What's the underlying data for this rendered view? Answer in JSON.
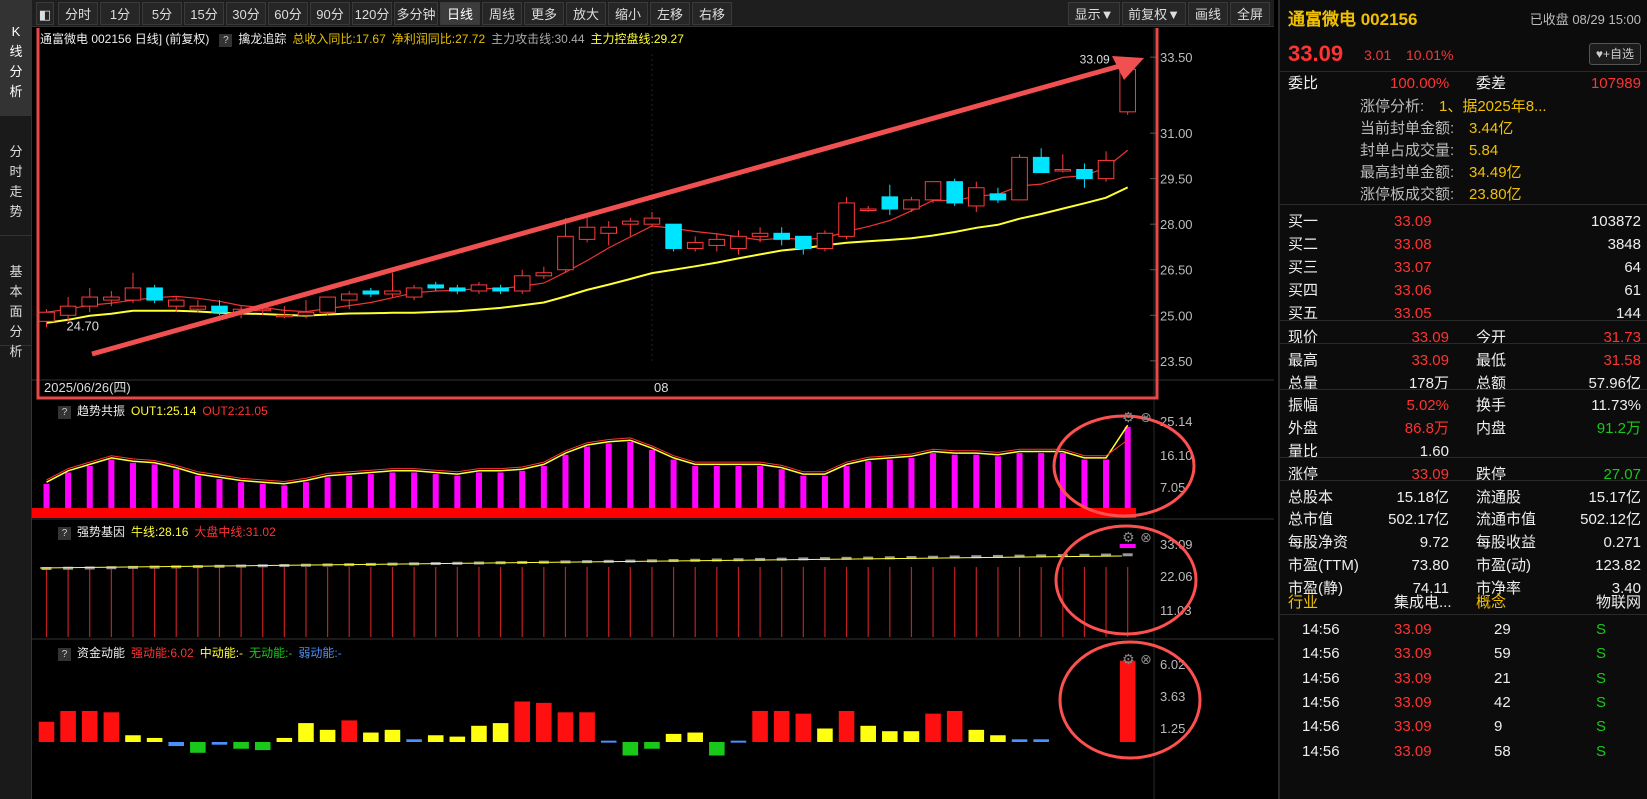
{
  "left_tabs": [
    "K线分析",
    "分时走势",
    "基本面分析"
  ],
  "toolbar": {
    "left": [
      "分时",
      "1分",
      "5分",
      "15分",
      "30分",
      "60分",
      "90分",
      "120分",
      "多分钟",
      "日线",
      "周线",
      "更多▼",
      "放大",
      "缩小",
      "左移",
      "右移"
    ],
    "right": [
      "显示▼",
      "前复权▼",
      "画线",
      "全屏"
    ],
    "active": "日线"
  },
  "main_panel": {
    "title": "通富微电 002156 日线] (前复权)",
    "indicator": "擒龙追踪",
    "vals": [
      {
        "t": "总收入同比:17.67",
        "c": "#e8c000"
      },
      {
        "t": "净利润同比:27.72",
        "c": "#e8c000"
      },
      {
        "t": "主力攻击线:30.44",
        "c": "#aaaaaa"
      },
      {
        "t": "主力控盘线:29.27",
        "c": "#ffff33"
      }
    ],
    "last_price_label": "33.09",
    "low_label": "24.70",
    "date_left": "2025/06/26(四)",
    "month_mark": "08",
    "ticks": [
      "33.50",
      "31.00",
      "29.50",
      "28.00",
      "26.50",
      "25.00",
      "23.50"
    ]
  },
  "trend_panel": {
    "name": "趋势共振",
    "vals": [
      {
        "t": "OUT1:25.14",
        "c": "#ffff33"
      },
      {
        "t": "OUT2:21.05",
        "c": "#ff3333"
      }
    ],
    "ticks": [
      "25.14",
      "16.10",
      "7.05"
    ]
  },
  "gene_panel": {
    "name": "强势基因",
    "vals": [
      {
        "t": "牛线:28.16",
        "c": "#ffff33"
      },
      {
        "t": "大盘中线:31.02",
        "c": "#ff3333"
      }
    ],
    "ticks": [
      "33.09",
      "22.06",
      "11.03"
    ]
  },
  "fund_panel": {
    "name": "资金动能",
    "vals": [
      {
        "t": "强动能:6.02",
        "c": "#ff3333"
      },
      {
        "t": "中动能:-",
        "c": "#ffff33"
      },
      {
        "t": "无动能:-",
        "c": "#19c819"
      },
      {
        "t": "弱动能:-",
        "c": "#4a90ff"
      }
    ],
    "ticks": [
      "6.02",
      "3.63",
      "1.25"
    ]
  },
  "quote": {
    "name": "通富微电 002156",
    "status": "已收盘 08/29 15:00",
    "price": "33.09",
    "change": "3.01",
    "change_pct": "10.01%",
    "add_fav": "+自选",
    "weibi_label": "委比",
    "weibi": "100.00%",
    "weicha_label": "委差",
    "weicha": "107989",
    "limit_info": [
      {
        "k": "涨停分析:",
        "v": "1、据2025年8..."
      },
      {
        "k": "当前封单金额:",
        "v": "3.44亿"
      },
      {
        "k": "封单占成交量:",
        "v": "5.84"
      },
      {
        "k": "最高封单金额:",
        "v": "34.49亿"
      },
      {
        "k": "涨停板成交额:",
        "v": "23.80亿"
      }
    ],
    "bids": [
      {
        "k": "买一",
        "p": "33.09",
        "v": "103872"
      },
      {
        "k": "买二",
        "p": "33.08",
        "v": "3848"
      },
      {
        "k": "买三",
        "p": "33.07",
        "v": "64"
      },
      {
        "k": "买四",
        "p": "33.06",
        "v": "61"
      },
      {
        "k": "买五",
        "p": "33.05",
        "v": "144"
      }
    ],
    "stats": [
      {
        "k1": "现价",
        "v1": "33.09",
        "c1": "red",
        "k2": "今开",
        "v2": "31.73",
        "c2": "red"
      },
      {
        "k1": "最高",
        "v1": "33.09",
        "c1": "red",
        "k2": "最低",
        "v2": "31.58",
        "c2": "red"
      },
      {
        "k1": "总量",
        "v1": "178万",
        "c1": "white",
        "k2": "总额",
        "v2": "57.96亿",
        "c2": "white"
      },
      {
        "k1": "振幅",
        "v1": "5.02%",
        "c1": "red",
        "k2": "换手",
        "v2": "11.73%",
        "c2": "white"
      },
      {
        "k1": "外盘",
        "v1": "86.8万",
        "c1": "red",
        "k2": "内盘",
        "v2": "91.2万",
        "c2": "green"
      },
      {
        "k1": "量比",
        "v1": "1.60",
        "c1": "white",
        "k2": "",
        "v2": "",
        "c2": "white"
      },
      {
        "k1": "涨停",
        "v1": "33.09",
        "c1": "red",
        "k2": "跌停",
        "v2": "27.07",
        "c2": "green"
      },
      {
        "k1": "总股本",
        "v1": "15.18亿",
        "c1": "white",
        "k2": "流通股",
        "v2": "15.17亿",
        "c2": "white"
      },
      {
        "k1": "总市值",
        "v1": "502.17亿",
        "c1": "white",
        "k2": "流通市值",
        "v2": "502.12亿",
        "c2": "white"
      },
      {
        "k1": "每股净资",
        "v1": "9.72",
        "c1": "white",
        "k2": "每股收益",
        "v2": "0.271",
        "c2": "white"
      },
      {
        "k1": "市盈(TTM)",
        "v1": "73.80",
        "c1": "white",
        "k2": "市盈(动)",
        "v2": "123.82",
        "c2": "white"
      },
      {
        "k1": "市盈(静)",
        "v1": "74.11",
        "c1": "white",
        "k2": "市净率",
        "v2": "3.40",
        "c2": "white"
      }
    ],
    "industry_label": "行业",
    "industry": "集成电...",
    "concept_label": "概念",
    "concept": "物联网",
    "ticks": [
      {
        "t": "14:56",
        "p": "33.09",
        "v": "29",
        "s": "S"
      },
      {
        "t": "14:56",
        "p": "33.09",
        "v": "59",
        "s": "S"
      },
      {
        "t": "14:56",
        "p": "33.09",
        "v": "21",
        "s": "S"
      },
      {
        "t": "14:56",
        "p": "33.09",
        "v": "42",
        "s": "S"
      },
      {
        "t": "14:56",
        "p": "33.09",
        "v": "9",
        "s": "S"
      },
      {
        "t": "14:56",
        "p": "33.09",
        "v": "58",
        "s": "S"
      }
    ]
  },
  "chart_data": {
    "type": "candlestick",
    "title": "通富微电 002156 日线",
    "ylim": [
      23.5,
      33.5
    ],
    "candles": [
      [
        24.8,
        25.2,
        24.6,
        25.1
      ],
      [
        25.0,
        25.6,
        24.8,
        25.3
      ],
      [
        25.3,
        25.9,
        25.1,
        25.6
      ],
      [
        25.5,
        25.8,
        25.3,
        25.6
      ],
      [
        25.5,
        26.4,
        25.4,
        25.9
      ],
      [
        25.9,
        26.0,
        25.4,
        25.5
      ],
      [
        25.3,
        25.6,
        25.1,
        25.5
      ],
      [
        25.2,
        25.5,
        25.1,
        25.3
      ],
      [
        25.3,
        25.5,
        25.0,
        25.1
      ],
      [
        25.1,
        25.3,
        24.9,
        25.2
      ],
      [
        25.2,
        25.3,
        25.0,
        25.2
      ],
      [
        25.0,
        25.3,
        24.9,
        25.0
      ],
      [
        25.0,
        25.5,
        24.9,
        25.1
      ],
      [
        25.1,
        25.6,
        25.0,
        25.6
      ],
      [
        25.5,
        25.8,
        25.2,
        25.7
      ],
      [
        25.8,
        25.9,
        25.6,
        25.7
      ],
      [
        25.7,
        26.4,
        25.6,
        25.8
      ],
      [
        25.6,
        26.0,
        25.5,
        25.9
      ],
      [
        26.0,
        26.1,
        25.8,
        25.9
      ],
      [
        25.9,
        26.0,
        25.7,
        25.8
      ],
      [
        25.8,
        26.1,
        25.7,
        26.0
      ],
      [
        25.9,
        26.0,
        25.7,
        25.8
      ],
      [
        25.8,
        26.5,
        25.7,
        26.3
      ],
      [
        26.3,
        26.6,
        26.2,
        26.4
      ],
      [
        26.5,
        28.2,
        26.4,
        27.6
      ],
      [
        27.5,
        28.3,
        27.4,
        27.9
      ],
      [
        27.7,
        28.1,
        27.3,
        27.9
      ],
      [
        28.0,
        28.2,
        27.6,
        28.1
      ],
      [
        28.0,
        28.4,
        27.9,
        28.2
      ],
      [
        28.0,
        28.0,
        27.1,
        27.2
      ],
      [
        27.2,
        27.6,
        27.1,
        27.4
      ],
      [
        27.3,
        27.7,
        27.1,
        27.5
      ],
      [
        27.2,
        27.8,
        27.0,
        27.6
      ],
      [
        27.6,
        27.9,
        27.4,
        27.7
      ],
      [
        27.7,
        27.9,
        27.3,
        27.5
      ],
      [
        27.6,
        27.6,
        27.0,
        27.2
      ],
      [
        27.2,
        27.8,
        27.1,
        27.7
      ],
      [
        27.6,
        28.9,
        27.5,
        28.7
      ],
      [
        28.5,
        28.6,
        28.4,
        28.5
      ],
      [
        28.9,
        29.3,
        28.3,
        28.5
      ],
      [
        28.5,
        28.9,
        28.4,
        28.8
      ],
      [
        28.8,
        29.4,
        28.7,
        29.4
      ],
      [
        29.4,
        29.5,
        28.6,
        28.7
      ],
      [
        28.6,
        29.4,
        28.4,
        29.2
      ],
      [
        29.0,
        29.2,
        28.7,
        28.8
      ],
      [
        28.8,
        30.3,
        28.8,
        30.2
      ],
      [
        30.2,
        30.5,
        29.8,
        29.7
      ],
      [
        29.8,
        30.3,
        29.7,
        29.8
      ],
      [
        29.8,
        30.0,
        29.2,
        29.5
      ],
      [
        29.5,
        30.4,
        29.4,
        30.1
      ],
      [
        31.7,
        33.1,
        31.6,
        33.1
      ]
    ]
  }
}
